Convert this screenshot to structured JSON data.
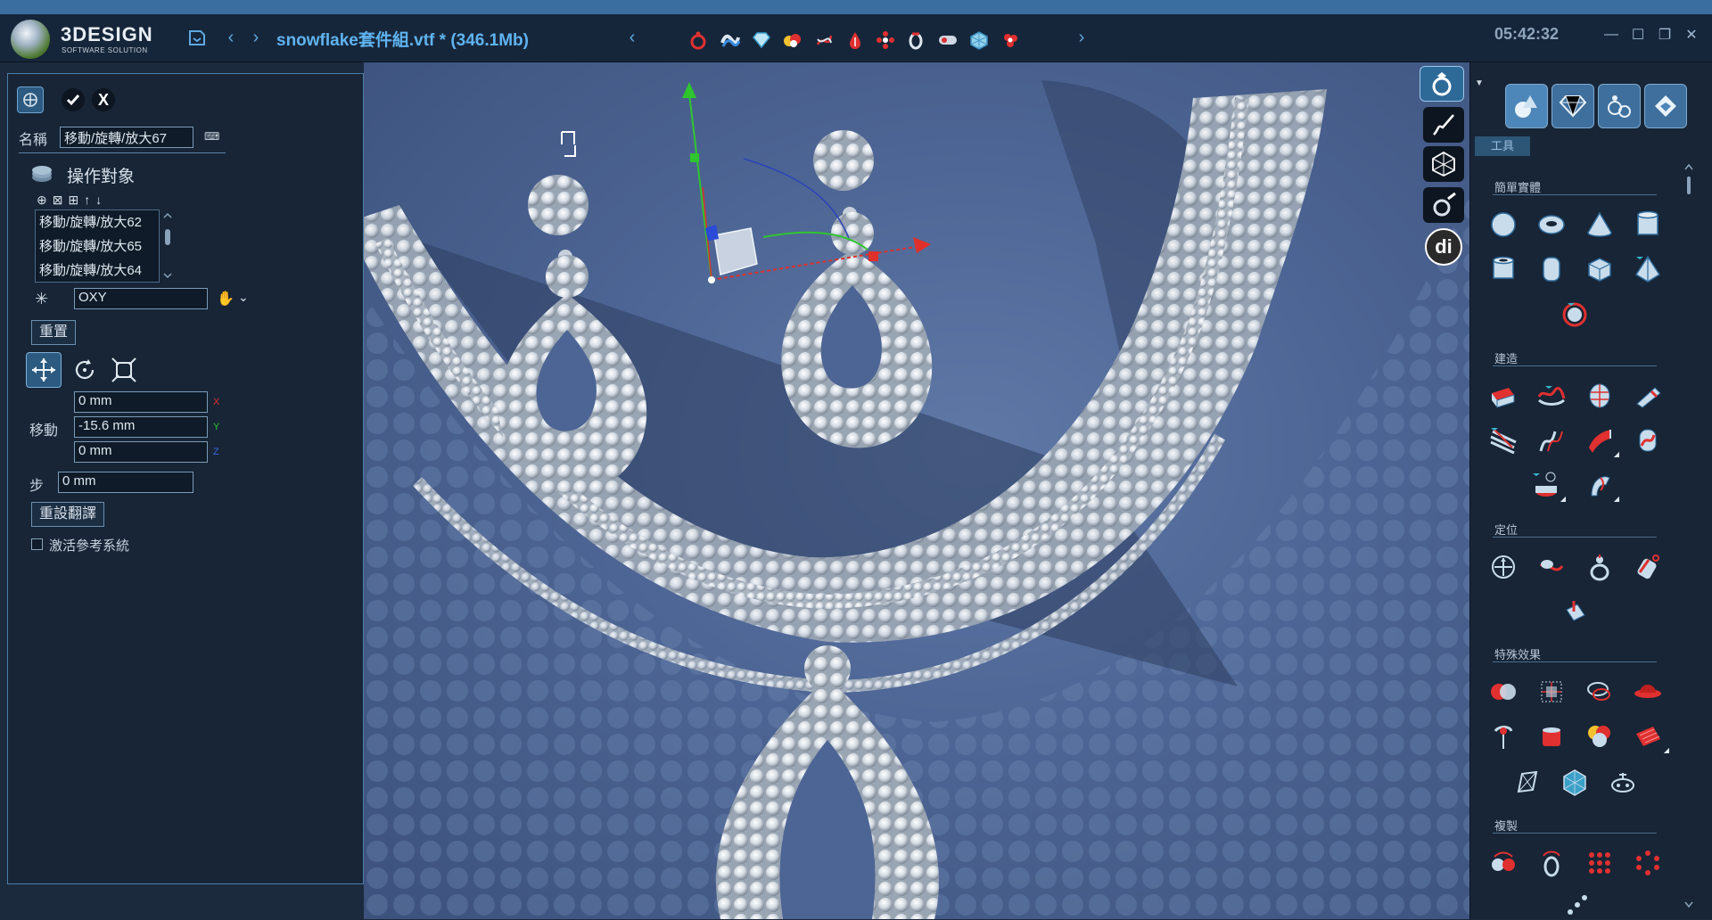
{
  "header": {
    "brand": "3DESIGN",
    "brand_sub": "SOFTWARE SOLUTION",
    "file_title": "snowflake套件組.vtf * (346.1Mb)",
    "clock": "05:42:32",
    "icons": [
      "save-icon",
      "back-arrow-icon",
      "forward-arrow-icon"
    ],
    "quick_tools": [
      "ring-red-icon",
      "wave-blue-icon",
      "diamond-icon",
      "color-dots-icon",
      "twist-icon",
      "drop-icon",
      "flower-dots-icon",
      "ring-side-icon",
      "pill-icon",
      "cube-icon",
      "cluster-icon"
    ],
    "window_controls": [
      "minimize",
      "maximize",
      "restore",
      "close"
    ]
  },
  "left_panel": {
    "name_label": "名稱",
    "name_value": "移動/旋轉/放大67",
    "section_title": "操作對象",
    "list_items": [
      "移動/旋轉/放大62",
      "移動/旋轉/放大65",
      "移動/旋轉/放大64"
    ],
    "plane_value": "OXY",
    "reset_label": "重置",
    "move_label": "移動",
    "move_x": "0 mm",
    "move_y": "-15.6 mm",
    "move_z": "0 mm",
    "axis_x": "X",
    "axis_y": "Y",
    "axis_z": "Z",
    "step_label": "步",
    "step_value": "0 mm",
    "reset_translate_label": "重設翻譯",
    "activate_ref_label": "激活參考系統"
  },
  "right_panel": {
    "tab_label": "工具",
    "groups": {
      "simple_solids": "簡單實體",
      "build": "建造",
      "position": "定位",
      "special_effects": "特殊效果",
      "copy": "複製"
    },
    "mode_buttons": [
      "ring-mode-icon",
      "sketch-mode-icon",
      "mesh-mode-icon",
      "render-mode-icon",
      "di-mode-icon"
    ],
    "di_label": "di"
  },
  "colors": {
    "accent": "#5fb3f0",
    "axis_x": "#e0302a",
    "axis_y": "#2fc52f",
    "axis_z": "#3a66e0",
    "viewport_bg": "#4d6594"
  }
}
